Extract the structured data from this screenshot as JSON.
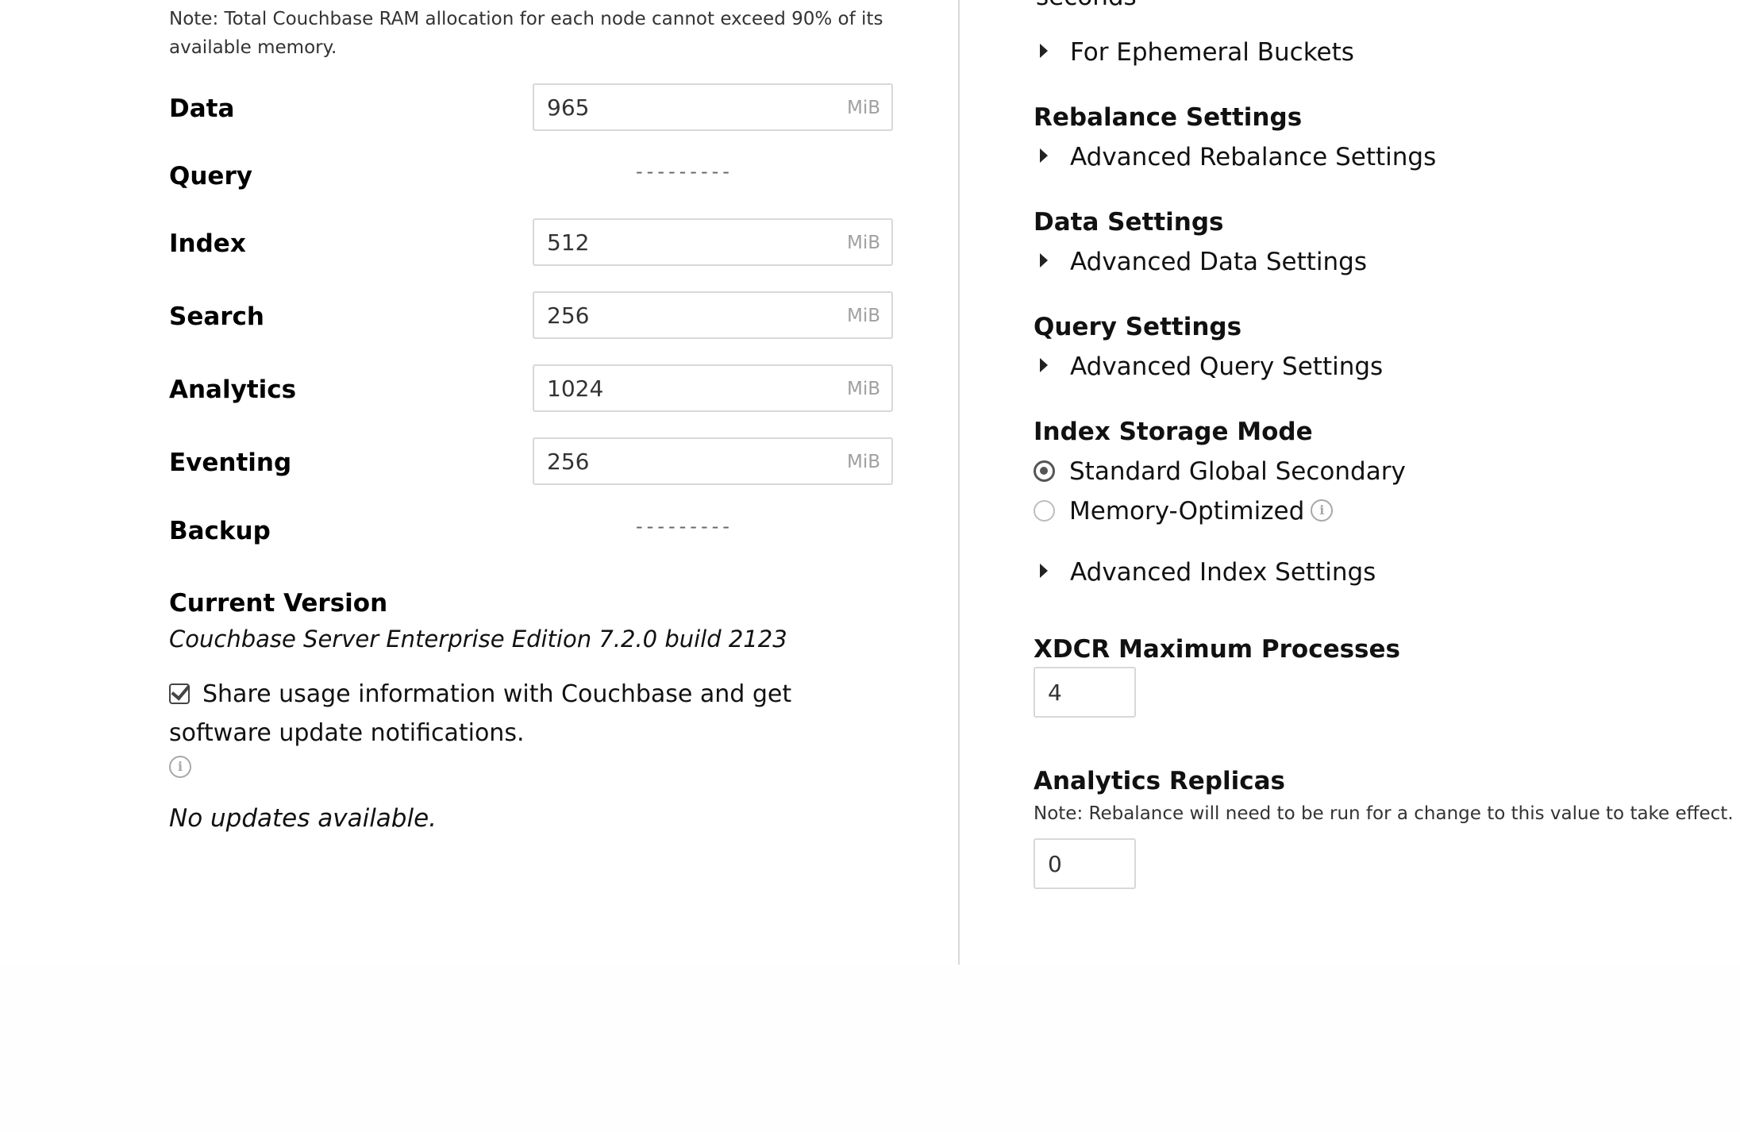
{
  "left": {
    "memory_note": "Note: Total Couchbase RAM allocation for each node cannot exceed 90% of its available memory.",
    "services": [
      {
        "label": "Data",
        "value": "965",
        "unit": "MiB",
        "has_input": true
      },
      {
        "label": "Query",
        "placeholder_dashes": "---------",
        "has_input": false
      },
      {
        "label": "Index",
        "value": "512",
        "unit": "MiB",
        "has_input": true
      },
      {
        "label": "Search",
        "value": "256",
        "unit": "MiB",
        "has_input": true
      },
      {
        "label": "Analytics",
        "value": "1024",
        "unit": "MiB",
        "has_input": true
      },
      {
        "label": "Eventing",
        "value": "256",
        "unit": "MiB",
        "has_input": true
      },
      {
        "label": "Backup",
        "placeholder_dashes": "---------",
        "has_input": false
      }
    ],
    "current_version": {
      "heading": "Current Version",
      "text": "Couchbase Server Enterprise Edition 7.2.0 build 2123"
    },
    "share_usage": {
      "checked": true,
      "label": "Share usage information with Couchbase and get software update notifications.",
      "info_icon": "info-circle-icon"
    },
    "updates_status": "No updates available."
  },
  "right": {
    "clipped_text": "seconds",
    "ephemeral_toggle": "For Ephemeral Buckets",
    "rebalance": {
      "heading": "Rebalance Settings",
      "toggle": "Advanced Rebalance Settings"
    },
    "data": {
      "heading": "Data Settings",
      "toggle": "Advanced Data Settings"
    },
    "query": {
      "heading": "Query Settings",
      "toggle": "Advanced Query Settings"
    },
    "index_storage": {
      "heading": "Index Storage Mode",
      "options": [
        {
          "label": "Standard Global Secondary",
          "selected": true
        },
        {
          "label": "Memory-Optimized",
          "selected": false,
          "info_icon": "info-circle-icon"
        }
      ],
      "toggle": "Advanced Index Settings"
    },
    "xdcr": {
      "heading": "XDCR Maximum Processes",
      "value": "4"
    },
    "analytics_replicas": {
      "heading": "Analytics Replicas",
      "note": "Note: Rebalance will need to be run for a change to this value to take effect.",
      "value": "0"
    }
  },
  "colors": {
    "text": "#111111",
    "note_text": "#333333",
    "border": "#d8d8d8",
    "unit_text": "#a0a0a0",
    "info_icon": "#a8a8a8",
    "divider": "#d8d8d8"
  }
}
